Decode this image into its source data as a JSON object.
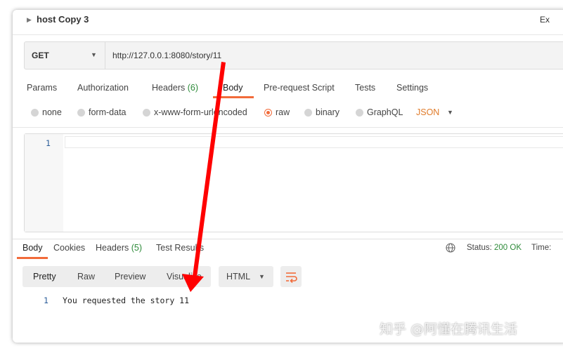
{
  "window": {
    "title": "host Copy 3",
    "right_label": "Ex"
  },
  "request": {
    "method": "GET",
    "url": "http://127.0.0.1:8080/story/11"
  },
  "request_tabs": {
    "params": "Params",
    "authorization": "Authorization",
    "headers": "Headers",
    "headers_count": "(6)",
    "body": "Body",
    "prerequest": "Pre-request Script",
    "tests": "Tests",
    "settings": "Settings"
  },
  "body_types": {
    "none": "none",
    "form_data": "form-data",
    "urlencoded": "x-www-form-urlencoded",
    "raw": "raw",
    "binary": "binary",
    "graphql": "GraphQL",
    "format": "JSON",
    "selected": "raw"
  },
  "editor": {
    "line_number": "1",
    "content": ""
  },
  "response_tabs": {
    "body": "Body",
    "cookies": "Cookies",
    "headers": "Headers",
    "headers_count": "(5)",
    "test_results": "Test Results"
  },
  "response_status": {
    "label": "Status:",
    "value": "200 OK",
    "time_label": "Time:"
  },
  "view_modes": {
    "pretty": "Pretty",
    "raw": "Raw",
    "preview": "Preview",
    "visualize": "Visualize",
    "selected": "Pretty"
  },
  "format_select": {
    "value": "HTML"
  },
  "response_body": {
    "line_number": "1",
    "text": "You requested the story 11"
  },
  "watermark": "知乎 @阿懂在腾讯生活",
  "colors": {
    "accent": "#f26b3a",
    "status_ok": "#2e8b3a",
    "annotation": "#ff0000"
  }
}
